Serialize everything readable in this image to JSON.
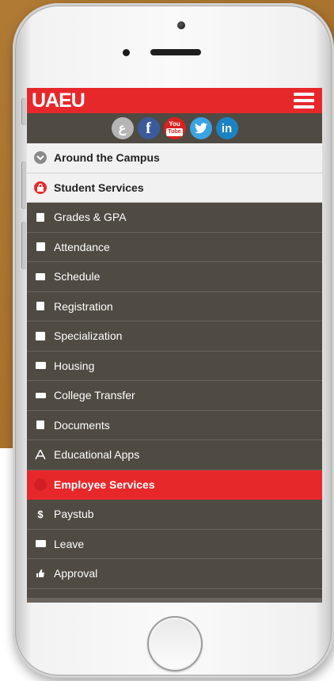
{
  "app": {
    "logo_text": "UAEU",
    "brand_color": "#e7282b",
    "menu_icon": "hamburger-menu-icon"
  },
  "social": [
    {
      "name": "e-services-icon",
      "glyph": "ع"
    },
    {
      "name": "facebook-icon",
      "glyph": "f"
    },
    {
      "name": "youtube-icon",
      "glyph_top": "You",
      "glyph_bottom": "Tube"
    },
    {
      "name": "twitter-icon",
      "glyph": "🐦"
    },
    {
      "name": "linkedin-icon",
      "glyph": "in"
    }
  ],
  "menu": {
    "around": "Around the Campus",
    "student_services": "Student Services",
    "student_items": [
      "Grades & GPA",
      "Attendance",
      "Schedule",
      "Registration",
      "Specialization",
      "Housing",
      "College Transfer",
      "Documents",
      "Educational Apps"
    ],
    "employee_services": "Employee Services",
    "employee_items": [
      "Paystub",
      "Leave",
      "Approval"
    ]
  }
}
